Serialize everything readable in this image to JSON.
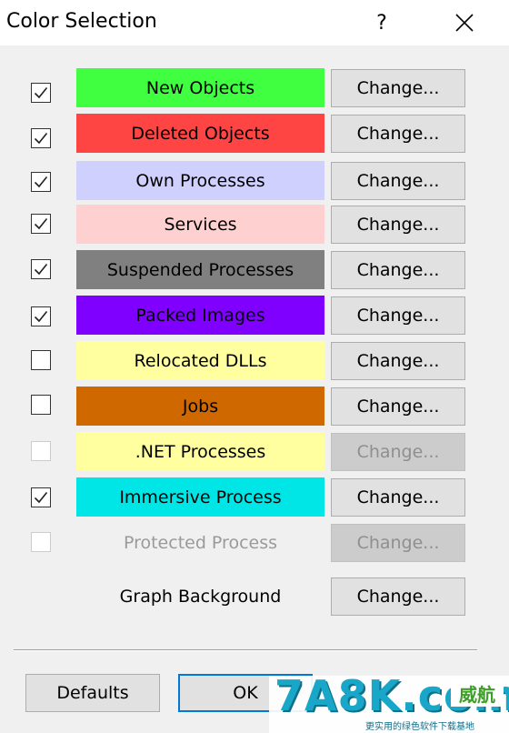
{
  "window": {
    "title": "Color Selection",
    "help_label": "?",
    "close_icon": "close-icon"
  },
  "rows": [
    {
      "label": "New Objects",
      "checked": true,
      "enabled": true,
      "color": "#40ff40",
      "text_color": "#000000",
      "button": "Change...",
      "button_enabled": true
    },
    {
      "label": "Deleted Objects",
      "checked": true,
      "enabled": true,
      "color": "#ff4444",
      "text_color": "#000000",
      "button": "Change...",
      "button_enabled": true
    },
    {
      "label": "Own Processes",
      "checked": true,
      "enabled": true,
      "color": "#d0d0ff",
      "text_color": "#000000",
      "button": "Change...",
      "button_enabled": true
    },
    {
      "label": "Services",
      "checked": true,
      "enabled": true,
      "color": "#ffd0d0",
      "text_color": "#000000",
      "button": "Change...",
      "button_enabled": true
    },
    {
      "label": "Suspended Processes",
      "checked": true,
      "enabled": true,
      "color": "#808080",
      "text_color": "#000000",
      "button": "Change...",
      "button_enabled": true
    },
    {
      "label": "Packed Images",
      "checked": true,
      "enabled": true,
      "color": "#8000ff",
      "text_color": "#000000",
      "button": "Change...",
      "button_enabled": true
    },
    {
      "label": "Relocated DLLs",
      "checked": false,
      "enabled": true,
      "color": "#ffffa0",
      "text_color": "#000000",
      "button": "Change...",
      "button_enabled": true
    },
    {
      "label": "Jobs",
      "checked": false,
      "enabled": true,
      "color": "#d06800",
      "text_color": "#000000",
      "button": "Change...",
      "button_enabled": true
    },
    {
      "label": ".NET Processes",
      "checked": false,
      "enabled": false,
      "color": "#ffffa0",
      "text_color": "#000000",
      "button": "Change...",
      "button_enabled": false
    },
    {
      "label": "Immersive Process",
      "checked": true,
      "enabled": true,
      "color": "#00e6e6",
      "text_color": "#000000",
      "button": "Change...",
      "button_enabled": true
    },
    {
      "label": "Protected Process",
      "checked": false,
      "enabled": false,
      "color": "",
      "text_color": "#9a9a9a",
      "button": "Change...",
      "button_enabled": false
    }
  ],
  "graph_background": {
    "label": "Graph Background",
    "button": "Change..."
  },
  "footer": {
    "defaults_label": "Defaults",
    "ok_label": "OK"
  },
  "watermark": {
    "main": "7A8K.com",
    "badge": "威航",
    "sub": "更实用的绿色软件下载基地"
  }
}
